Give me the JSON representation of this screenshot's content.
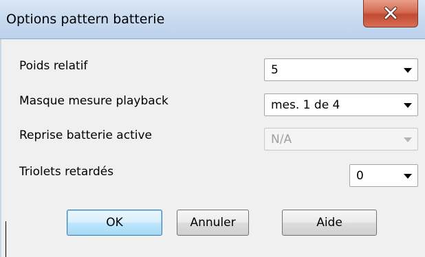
{
  "window": {
    "title": "Options pattern batterie",
    "close_icon": "close-icon"
  },
  "fields": {
    "relative_weight": {
      "label": "Poids relatif",
      "value": "5"
    },
    "playback_mask": {
      "label": "Masque mesure playback",
      "value": "mes. 1 de 4"
    },
    "drum_repeat": {
      "label": "Reprise batterie active",
      "value": "N/A"
    },
    "delayed_triplets": {
      "label": "Triolets retardés",
      "value": "0"
    }
  },
  "buttons": {
    "ok": "OK",
    "cancel": "Annuler",
    "help": "Aide"
  }
}
